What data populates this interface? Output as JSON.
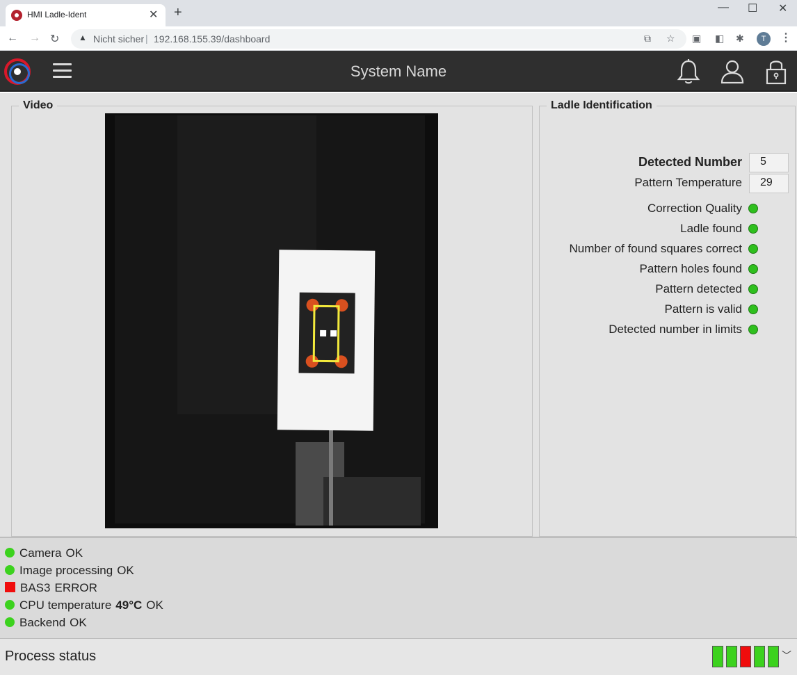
{
  "browser": {
    "tab_title": "HMI Ladle-Ident",
    "not_secure": "Nicht sicher",
    "url": "192.168.155.39/dashboard",
    "profile_initial": "T"
  },
  "header": {
    "system_name": "System Name"
  },
  "video_panel": {
    "title": "Video"
  },
  "ladle_panel": {
    "title": "Ladle Identification",
    "detected_number_label": "Detected Number",
    "detected_number_value": "5",
    "pattern_temperature_label": "Pattern Temperature",
    "pattern_temperature_value": "29",
    "indicators": [
      {
        "label": "Correction Quality",
        "status": "ok"
      },
      {
        "label": "Ladle found",
        "status": "ok"
      },
      {
        "label": "Number of found squares correct",
        "status": "ok"
      },
      {
        "label": "Pattern holes found",
        "status": "ok"
      },
      {
        "label": "Pattern detected",
        "status": "ok"
      },
      {
        "label": "Pattern is valid",
        "status": "ok"
      },
      {
        "label": "Detected number in limits",
        "status": "ok"
      }
    ]
  },
  "system_status": [
    {
      "name": "Camera",
      "state": "OK",
      "status": "ok"
    },
    {
      "name": "Image processing",
      "state": "OK",
      "status": "ok"
    },
    {
      "name": "BAS3",
      "state": "ERROR",
      "status": "error"
    },
    {
      "name": "CPU temperature",
      "value": "49°C",
      "state": "OK",
      "status": "ok"
    },
    {
      "name": "Backend",
      "state": "OK",
      "status": "ok"
    }
  ],
  "process": {
    "label": "Process status",
    "segments": [
      "ok",
      "ok",
      "error",
      "ok",
      "ok"
    ]
  },
  "colors": {
    "ok": "#3cd21e",
    "error": "#f00c0c",
    "header_bg": "#2f2f2f"
  }
}
